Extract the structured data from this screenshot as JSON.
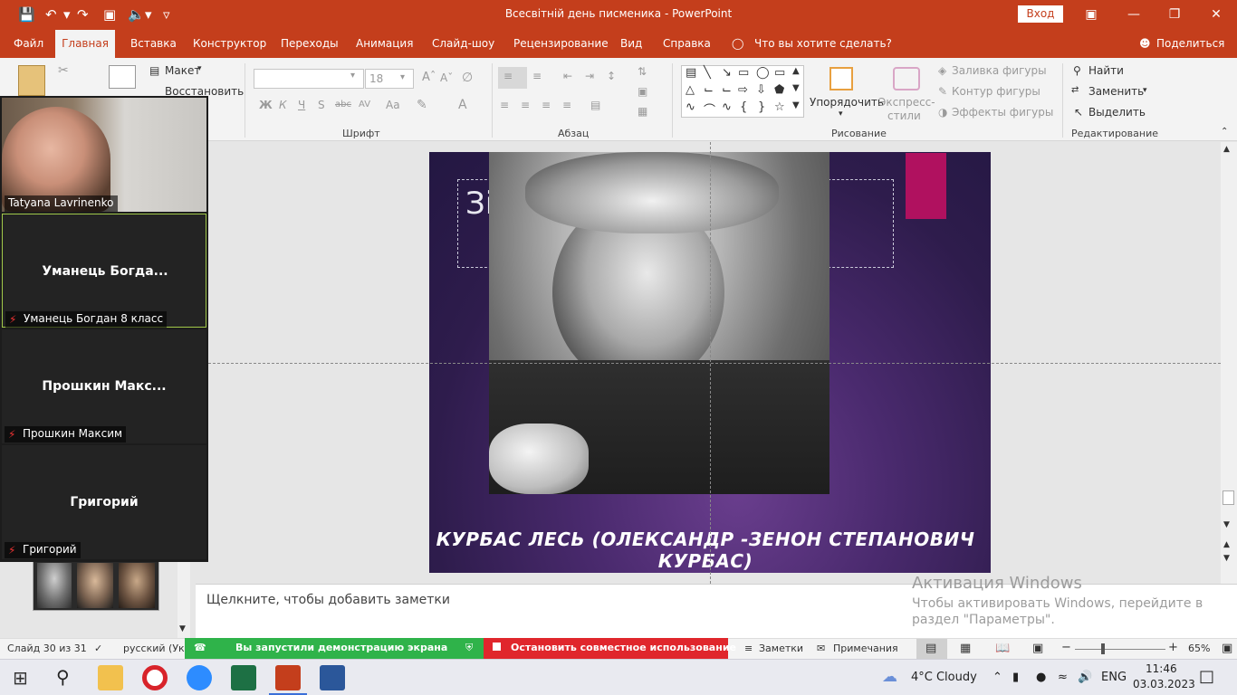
{
  "window": {
    "doc_title": "Всесвітній день писменика  -  PowerPoint",
    "signin_label": "Вход"
  },
  "ribbon": {
    "tabs": [
      "Файл",
      "Главная",
      "Вставка",
      "Конструктор",
      "Переходы",
      "Анимация",
      "Слайд-шоу",
      "Рецензирование",
      "Вид",
      "Справка"
    ],
    "tell_me": "Что вы хотите сделать?",
    "share_label": "Поделиться",
    "layout_label": "Макет",
    "reset_label": "Восстановить",
    "font_size": "18",
    "bold": "Ж",
    "italic": "К",
    "underline": "Ч",
    "shadow": "S",
    "strike": "abc",
    "spacing": "AV",
    "case": "Aa",
    "groups": {
      "font": "Шрифт",
      "paragraph": "Абзац",
      "drawing": "Рисование",
      "editing": "Редактирование"
    },
    "arrange_label": "Упорядочить",
    "quick_styles_label": "Экспресс-\nстили",
    "shape_fill": "Заливка фигуры",
    "shape_outline": "Контур фигуры",
    "shape_effects": "Эффекты фигуры",
    "find_label": "Найти",
    "replace_label": "Заменить",
    "select_label": "Выделить"
  },
  "slide": {
    "title_partial": "Зі",
    "caption": "КУРБАС ЛЕСЬ (ОЛЕКСАНДР -ЗЕНОН СТЕПАНОВИЧ КУРБАС)",
    "accent_color": "#b0115f"
  },
  "notes": {
    "placeholder": "Щелкните, чтобы добавить заметки"
  },
  "watermark": {
    "title": "Активация Windows",
    "line1": "Чтобы активировать Windows, перейдите в",
    "line2": "раздел \"Параметры\"."
  },
  "zoom": {
    "participants": [
      {
        "display": "Tatyana Lavrinenko",
        "label": "Tatyana Lavrinenko",
        "has_video": true
      },
      {
        "display": "Уманець  Богда...",
        "label": "Уманець Богдан 8 класс",
        "muted": true,
        "active": true
      },
      {
        "display": "Прошкин  Макс...",
        "label": "Прошкин Максим",
        "muted": true
      },
      {
        "display": "Григорий",
        "label": "Григорий",
        "muted": true
      }
    ],
    "share_banner": "Вы запустили демонстрацию экрана",
    "stop_share": "Остановить совместное использование"
  },
  "status": {
    "slide_counter": "Слайд 30 из 31",
    "language": "русский (Укр",
    "notes_label": "Заметки",
    "comments_label": "Примечания",
    "zoom_level": "65%"
  },
  "taskbar": {
    "weather": "4°C  Cloudy",
    "lang": "ENG",
    "time": "11:46",
    "date": "03.03.2023"
  }
}
